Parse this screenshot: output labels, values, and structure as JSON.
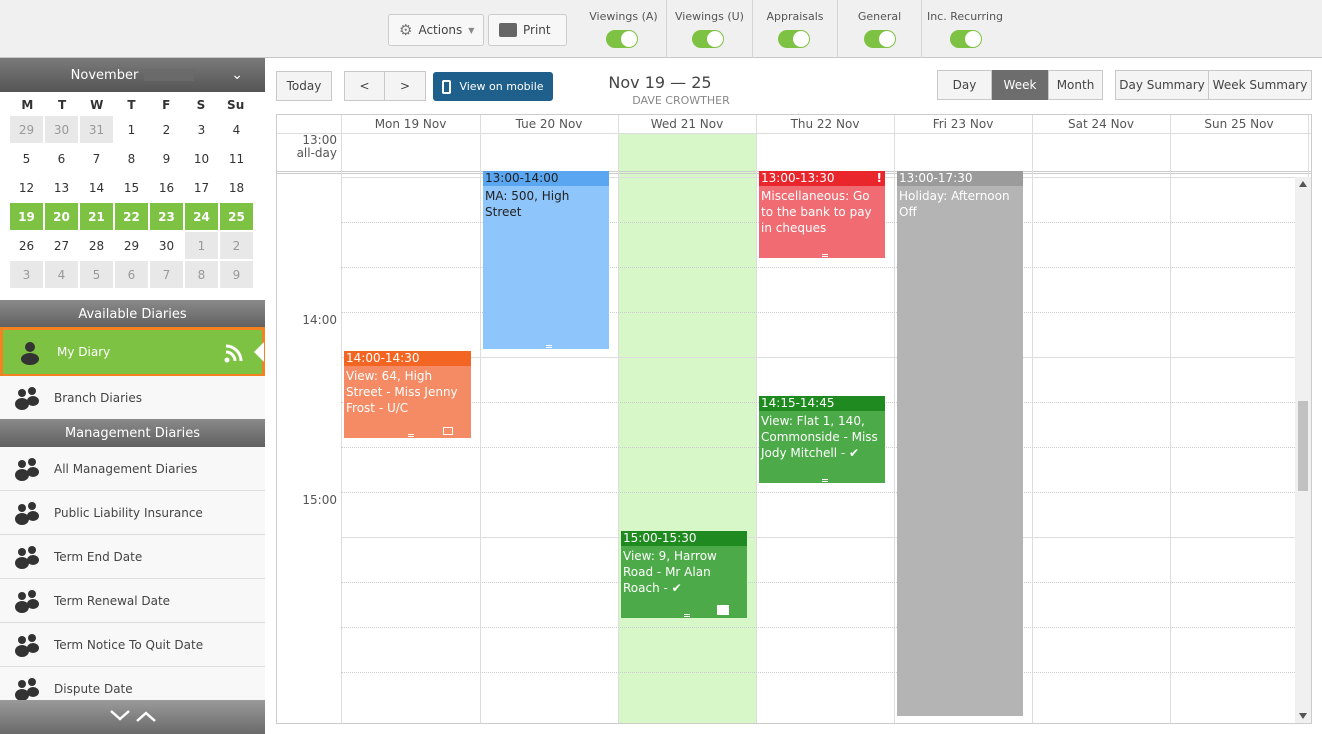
{
  "toolbar": {
    "actions": "Actions",
    "print": "Print",
    "toggles": [
      {
        "label": "Viewings (A)"
      },
      {
        "label": "Viewings (U)"
      },
      {
        "label": "Appraisals"
      },
      {
        "label": "General"
      },
      {
        "label": "Inc. Recurring"
      }
    ]
  },
  "sidebar": {
    "month": "November",
    "dow": [
      "M",
      "T",
      "W",
      "T",
      "F",
      "S",
      "Su"
    ],
    "weeks": [
      [
        "29",
        "30",
        "31",
        "1",
        "2",
        "3",
        "4"
      ],
      [
        "5",
        "6",
        "7",
        "8",
        "9",
        "10",
        "11"
      ],
      [
        "12",
        "13",
        "14",
        "15",
        "16",
        "17",
        "18"
      ],
      [
        "19",
        "20",
        "21",
        "22",
        "23",
        "24",
        "25"
      ],
      [
        "26",
        "27",
        "28",
        "29",
        "30",
        "1",
        "2"
      ],
      [
        "3",
        "4",
        "5",
        "6",
        "7",
        "8",
        "9"
      ]
    ],
    "available_title": "Available Diaries",
    "my_diary": "My Diary",
    "branch_diaries": "Branch Diaries",
    "management_title": "Management Diaries",
    "management_items": [
      "All Management Diaries",
      "Public Liability Insurance",
      "Term End Date",
      "Term Renewal Date",
      "Term Notice To Quit Date",
      "Dispute Date"
    ]
  },
  "calendar": {
    "today": "Today",
    "prev": "<",
    "next": ">",
    "mobile": "View on mobile",
    "range": "Nov 19 — 25",
    "owner": "DAVE CROWTHER",
    "views": [
      "Day",
      "Week",
      "Month"
    ],
    "summaries": [
      "Day Summary",
      "Week Summary"
    ],
    "columns": [
      "Mon 19 Nov",
      "Tue 20 Nov",
      "Wed 21 Nov",
      "Thu 22 Nov",
      "Fri 23 Nov",
      "Sat 24 Nov",
      "Sun 25 Nov"
    ],
    "allday": "all-day",
    "times": [
      "13:00",
      "14:00",
      "15:00"
    ],
    "events": [
      {
        "time": "13:00-14:00",
        "title": "MA: 500, High Street",
        "color": "#8ec5fb",
        "hcolor": "#5aa6f0",
        "dark": true
      },
      {
        "time": "13:00-13:30",
        "title": "Miscellaneous: Go to the bank to pay in cheques",
        "color": "#f06c72",
        "hcolor": "#e8262c",
        "flag": "!"
      },
      {
        "time": "13:00-17:30",
        "title": "Holiday: Afternoon Off",
        "color": "#b4b4b4",
        "hcolor": "#9b9b9b"
      },
      {
        "time": "14:00-14:30",
        "title": "View: 64, High Street - Miss Jenny Frost - U/C",
        "color": "#f58b64",
        "hcolor": "#f26522"
      },
      {
        "time": "14:15-14:45",
        "title": "View: Flat 1, 140, Commonside - Miss Jody Mitchell - ✔",
        "color": "#4caa48",
        "hcolor": "#1f8a1f"
      },
      {
        "time": "15:00-15:30",
        "title": "View: 9, Harrow Road - Mr Alan Roach - ✔",
        "color": "#4caa48",
        "hcolor": "#1f8a1f"
      }
    ]
  },
  "colors": {
    "accent": "#7dc242",
    "highlight": "#f58220",
    "today_col": "#d7f7c8",
    "mobile_btn": "#1f5f8b"
  }
}
